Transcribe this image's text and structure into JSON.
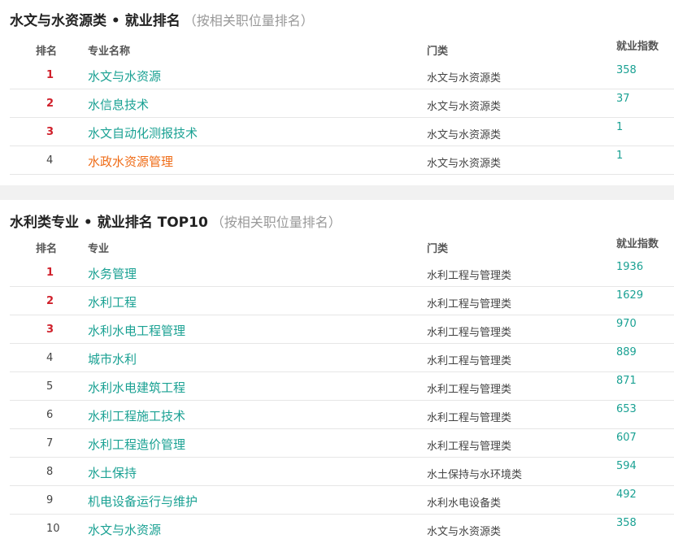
{
  "section1": {
    "title": "水文与水资源类 • 就业排名",
    "subtitle": "（按相关职位量排名）",
    "headers": {
      "rank": "排名",
      "name": "专业名称",
      "category": "门类",
      "index": "就业指数"
    },
    "rows": [
      {
        "rank": "1",
        "name": "水文与水资源",
        "category": "水文与水资源类",
        "index": "358"
      },
      {
        "rank": "2",
        "name": "水信息技术",
        "category": "水文与水资源类",
        "index": "37"
      },
      {
        "rank": "3",
        "name": "水文自动化测报技术",
        "category": "水文与水资源类",
        "index": "1"
      },
      {
        "rank": "4",
        "name": "水政水资源管理",
        "category": "水文与水资源类",
        "index": "1"
      }
    ]
  },
  "section2": {
    "title": "水利类专业 • 就业排名 TOP10",
    "subtitle": "（按相关职位量排名）",
    "headers": {
      "rank": "排名",
      "name": "专业",
      "category": "门类",
      "index": "就业指数"
    },
    "rows": [
      {
        "rank": "1",
        "name": "水务管理",
        "category": "水利工程与管理类",
        "index": "1936"
      },
      {
        "rank": "2",
        "name": "水利工程",
        "category": "水利工程与管理类",
        "index": "1629"
      },
      {
        "rank": "3",
        "name": "水利水电工程管理",
        "category": "水利工程与管理类",
        "index": "970"
      },
      {
        "rank": "4",
        "name": "城市水利",
        "category": "水利工程与管理类",
        "index": "889"
      },
      {
        "rank": "5",
        "name": "水利水电建筑工程",
        "category": "水利工程与管理类",
        "index": "871"
      },
      {
        "rank": "6",
        "name": "水利工程施工技术",
        "category": "水利工程与管理类",
        "index": "653"
      },
      {
        "rank": "7",
        "name": "水利工程造价管理",
        "category": "水利工程与管理类",
        "index": "607"
      },
      {
        "rank": "8",
        "name": "水土保持",
        "category": "水土保持与水环境类",
        "index": "594"
      },
      {
        "rank": "9",
        "name": "机电设备运行与维护",
        "category": "水利水电设备类",
        "index": "492"
      },
      {
        "rank": "10",
        "name": "水文与水资源",
        "category": "水文与水资源类",
        "index": "358"
      }
    ]
  },
  "colors": {
    "accent": "#1aa193",
    "highlight": "#ef6c17",
    "top_rank": "#d0202b",
    "divider": "#f1f1f1"
  }
}
